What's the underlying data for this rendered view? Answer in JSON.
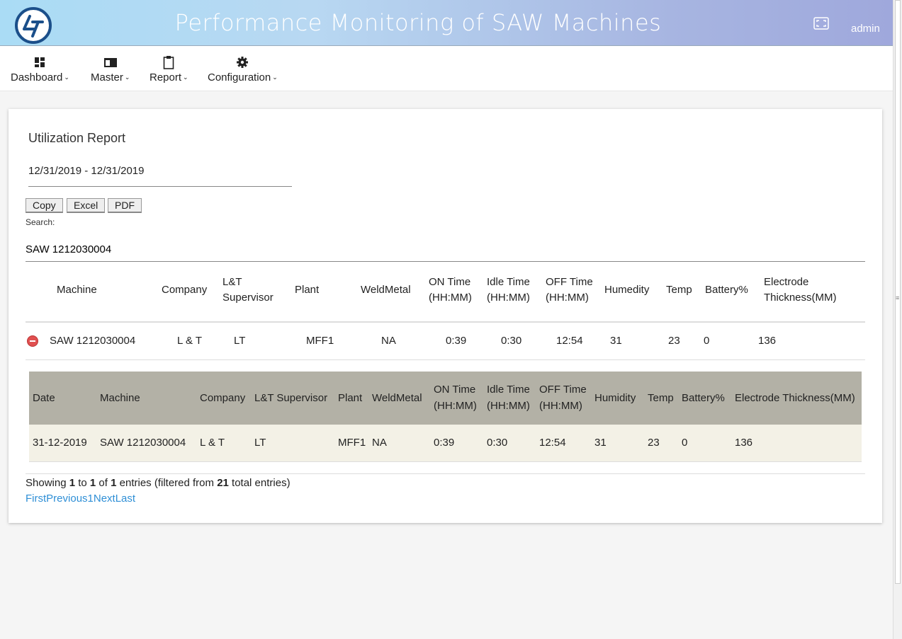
{
  "header": {
    "title": "Performance Monitoring of SAW Machines",
    "user": "admin"
  },
  "nav": [
    {
      "label": "Dashboard",
      "icon": "dashboard-icon"
    },
    {
      "label": "Master",
      "icon": "master-icon"
    },
    {
      "label": "Report",
      "icon": "clipboard-icon"
    },
    {
      "label": "Configuration",
      "icon": "gear-icon"
    }
  ],
  "report": {
    "title": "Utilization Report",
    "date_range": "12/31/2019 - 12/31/2019",
    "buttons": [
      "Copy",
      "Excel",
      "PDF"
    ],
    "search_label": "Search:",
    "search_value": "SAW 1212030004"
  },
  "main_table": {
    "headers": [
      "Machine",
      "Company",
      "L&T\nSupervisor",
      "Plant",
      "WeldMetal",
      "ON Time\n(HH:MM)",
      "Idle Time\n(HH:MM)",
      "OFF Time\n(HH:MM)",
      "Humedity",
      "Temp",
      "Battery%",
      "Electrode\nThickness(MM)"
    ],
    "row": [
      "SAW 1212030004",
      "L & T",
      "LT",
      "MFF1",
      "NA",
      "0:39",
      "0:30",
      "12:54",
      "31",
      "23",
      "0",
      "136"
    ]
  },
  "child_table": {
    "headers": [
      "Date",
      "Machine",
      "Company",
      "L&T Supervisor",
      "Plant",
      "WeldMetal",
      "ON Time\n(HH:MM)",
      "Idle Time\n(HH:MM)",
      "OFF Time\n(HH:MM)",
      "Humidity",
      "Temp",
      "Battery%",
      "Electrode Thickness(MM)"
    ],
    "row": [
      "31-12-2019",
      "SAW 1212030004",
      "L & T",
      "LT",
      "MFF1",
      "NA",
      "0:39",
      "0:30",
      "12:54",
      "31",
      "23",
      "0",
      "136"
    ]
  },
  "info": {
    "prefix": "Showing ",
    "start": "1",
    "to": " to ",
    "end": "1",
    "of": " of ",
    "total": "1",
    "suffix": " entries (filtered from ",
    "max": "21",
    "tail": " total entries)"
  },
  "pager": [
    "First",
    "Previous",
    "1",
    "Next",
    "Last"
  ],
  "colors": {
    "accent": "#2f8fd6",
    "child_header": "#b3b1a6",
    "child_row": "#f3f1e6"
  }
}
